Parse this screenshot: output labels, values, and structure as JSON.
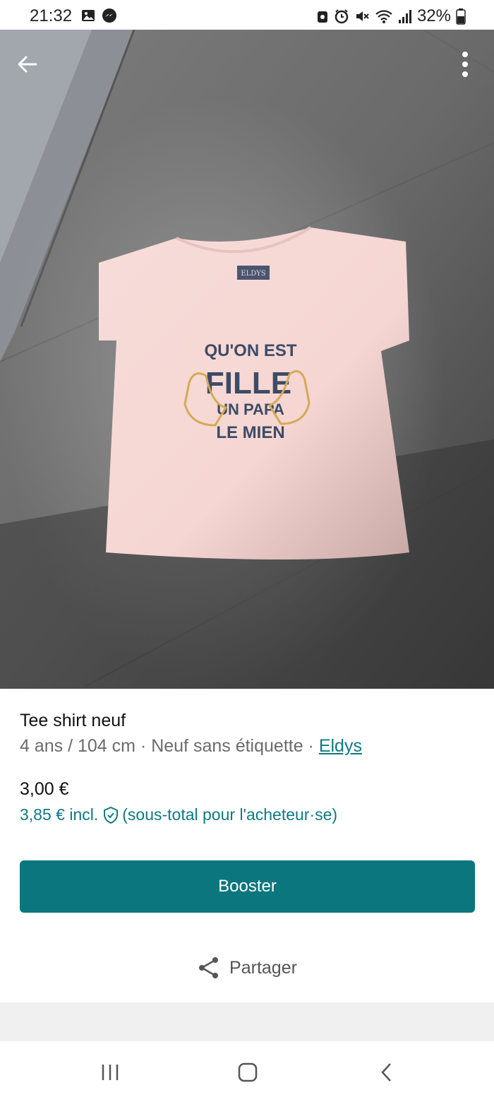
{
  "status_bar": {
    "time": "21:32",
    "battery_percent": "32%",
    "left_icons": [
      "gallery-icon",
      "messenger-icon"
    ],
    "right_icons": [
      "vpn-icon",
      "alarm-icon",
      "mute-icon",
      "wifi-icon",
      "signal-icon",
      "battery-icon"
    ]
  },
  "header": {
    "back_icon": "arrow-left-icon",
    "menu_icon": "more-vertical-icon"
  },
  "photo": {
    "shirt_label": "ELDYS",
    "print_lines": [
      "QU'ON EST",
      "FILLE",
      "UN PAPA",
      "LE MIEN"
    ]
  },
  "item": {
    "title": "Tee shirt neuf",
    "details": "4 ans / 104 cm · Neuf sans étiquette · ",
    "brand": "Eldys",
    "price": "3,00 €",
    "price_incl": "3,85 € incl.",
    "price_incl_note": "(sous-total pour l'acheteur·se)"
  },
  "actions": {
    "booster_label": "Booster",
    "share_label": "Partager"
  },
  "colors": {
    "accent": "#0b767d",
    "link": "#0e7a80"
  },
  "navbar": {
    "icons": [
      "recents-icon",
      "home-icon",
      "back-icon"
    ]
  }
}
